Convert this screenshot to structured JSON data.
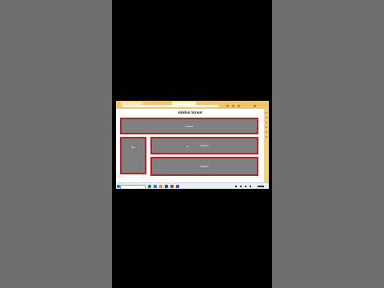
{
  "page": {
    "title": "sidebar layout"
  },
  "layout_boxes": {
    "header": "Header",
    "nav": "Nav",
    "section1": "Section",
    "section2": "Section"
  },
  "colors": {
    "page_background": "#6e6e6e",
    "video_frame": "#000000",
    "browser_chrome": "#f2c46b",
    "box_fill": "#808080",
    "box_border": "#e21c1c"
  },
  "icons": [
    "browser-tab-icon",
    "windows-start-icon",
    "search-icon",
    "taskbar-app-icon",
    "system-tray-icon"
  ]
}
